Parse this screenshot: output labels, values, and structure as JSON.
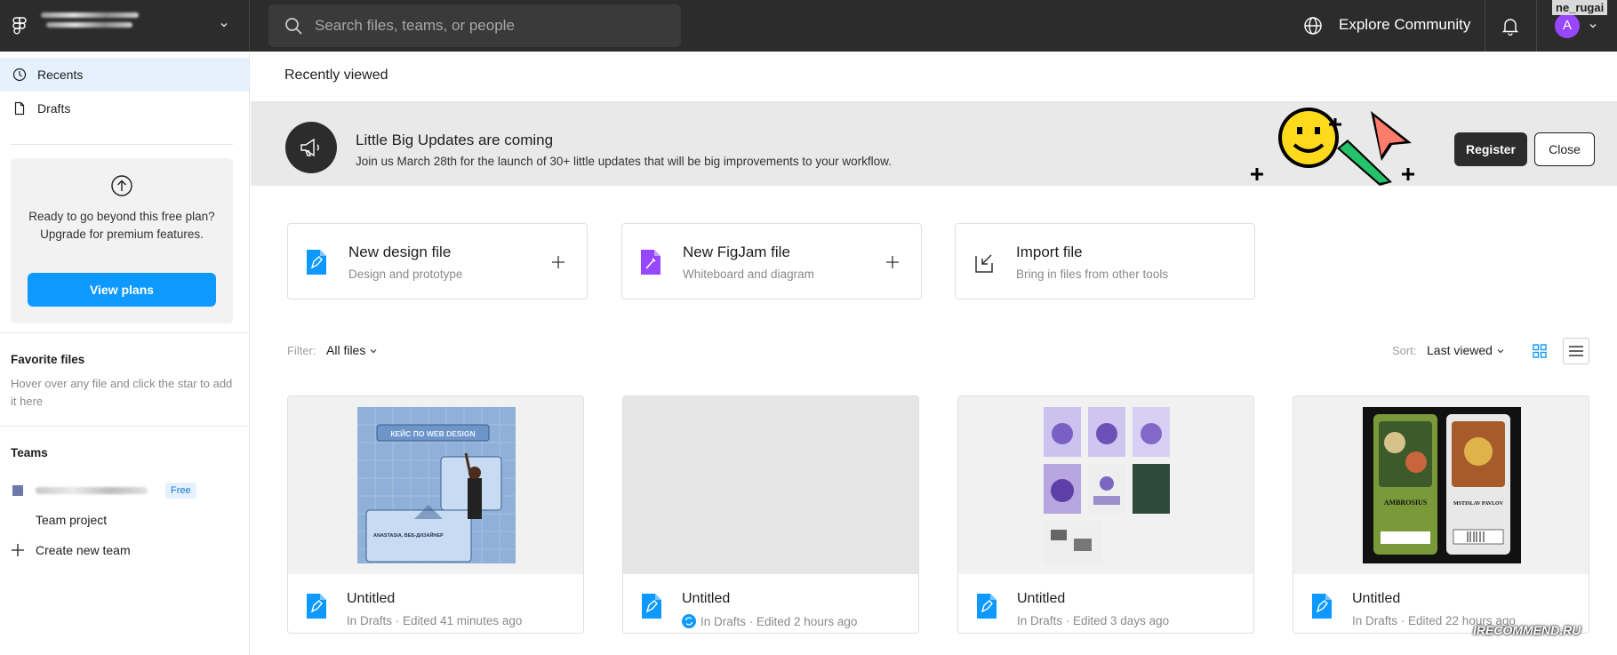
{
  "topbar": {
    "search_placeholder": "Search files, teams, or people",
    "explore_label": "Explore Community",
    "avatar_letter": "A",
    "username": "ne_rugai"
  },
  "sidebar": {
    "items": [
      {
        "label": "Recents",
        "icon": "clock-icon",
        "active": true
      },
      {
        "label": "Drafts",
        "icon": "file-icon",
        "active": false
      }
    ],
    "upgrade": {
      "text": "Ready to go beyond this free plan? Upgrade for premium features.",
      "button": "View plans"
    },
    "favorites": {
      "heading": "Favorite files",
      "hint": "Hover over any file and click the star to add it here"
    },
    "teams": {
      "heading": "Teams",
      "badge": "Free",
      "project": "Team project",
      "create": "Create new team"
    }
  },
  "main": {
    "title": "Recently viewed",
    "banner": {
      "title": "Little Big Updates are coming",
      "subtitle": "Join us March 28th for the launch of 30+ little updates that will be big improvements to your workflow.",
      "register": "Register",
      "close": "Close"
    },
    "actions": [
      {
        "title": "New design file",
        "subtitle": "Design and prototype",
        "icon": "design-file-icon"
      },
      {
        "title": "New FigJam file",
        "subtitle": "Whiteboard and diagram",
        "icon": "figjam-file-icon"
      },
      {
        "title": "Import file",
        "subtitle": "Bring in files from other tools",
        "icon": "import-icon"
      }
    ],
    "filter": {
      "label": "Filter:",
      "value": "All files"
    },
    "sort": {
      "label": "Sort:",
      "value": "Last viewed"
    },
    "files": [
      {
        "title": "Untitled",
        "meta": "In Drafts · Edited 41 minutes ago",
        "thumb_heading": "КЕЙС ПО WEB DESIGN",
        "thumb_caption": "ANASTASIA, ВЕБ-ДИЗАЙНЕР"
      },
      {
        "title": "Untitled",
        "meta": "In Drafts · Edited 2 hours ago"
      },
      {
        "title": "Untitled",
        "meta": "In Drafts · Edited 3 days ago"
      },
      {
        "title": "Untitled",
        "meta": "In Drafts · Edited 22 hours ago",
        "thumb_left": "AMBROSIUS",
        "thumb_right": "MSTISLAV PAVLOV"
      }
    ]
  },
  "watermark": "IRECOMMEND.RU",
  "colors": {
    "accent": "#0d99ff",
    "topbar": "#2c2c2c",
    "figjam": "#9747ff",
    "active_nav": "#e5f1fd"
  }
}
